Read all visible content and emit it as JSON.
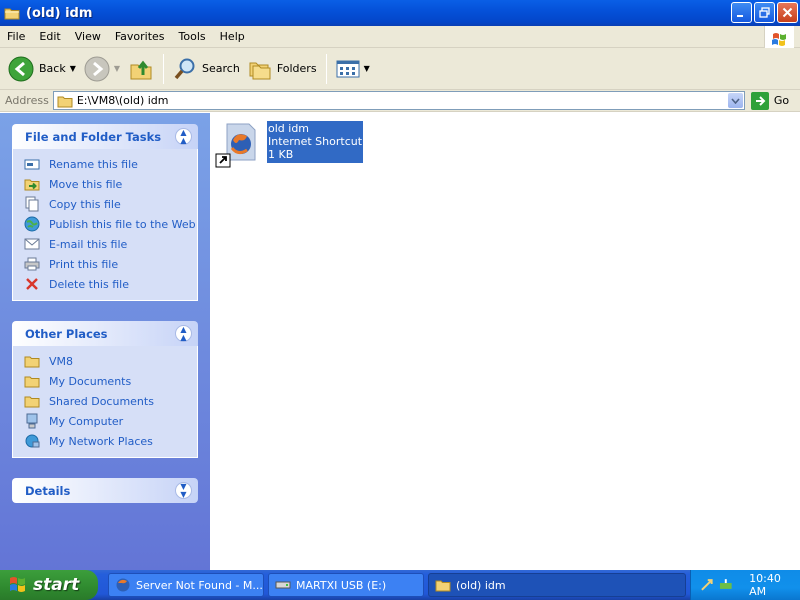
{
  "window": {
    "title": "(old) idm"
  },
  "menu": [
    "File",
    "Edit",
    "View",
    "Favorites",
    "Tools",
    "Help"
  ],
  "toolbar": {
    "back": "Back",
    "search": "Search",
    "folders": "Folders"
  },
  "address": {
    "label": "Address",
    "value": "E:\\VM8\\(old) idm",
    "go": "Go"
  },
  "file_tasks": {
    "title": "File and Folder Tasks",
    "items": [
      {
        "label": "Rename this file",
        "icon": "rename-icon"
      },
      {
        "label": "Move this file",
        "icon": "move-icon"
      },
      {
        "label": "Copy this file",
        "icon": "copy-icon"
      },
      {
        "label": "Publish this file to the Web",
        "icon": "publish-icon"
      },
      {
        "label": "E-mail this file",
        "icon": "email-icon"
      },
      {
        "label": "Print this file",
        "icon": "print-icon"
      },
      {
        "label": "Delete this file",
        "icon": "delete-icon"
      }
    ]
  },
  "other_places": {
    "title": "Other Places",
    "items": [
      {
        "label": "VM8",
        "icon": "folder-icon"
      },
      {
        "label": "My Documents",
        "icon": "folder-icon"
      },
      {
        "label": "Shared Documents",
        "icon": "folder-icon"
      },
      {
        "label": "My Computer",
        "icon": "computer-icon"
      },
      {
        "label": "My Network Places",
        "icon": "network-icon"
      }
    ]
  },
  "details": {
    "title": "Details"
  },
  "file": {
    "name": "old idm",
    "type": "Internet Shortcut",
    "size": "1 KB"
  },
  "taskbar": {
    "start": "start",
    "tasks": [
      "Server Not Found - M...",
      "MARTXI USB (E:)",
      "(old) idm"
    ],
    "clock": "10:40 AM"
  },
  "colors": {
    "titlebar": "#0a5fe6",
    "task_link": "#215dc6",
    "selection": "#316ac5",
    "start": "#3c9e3c"
  }
}
